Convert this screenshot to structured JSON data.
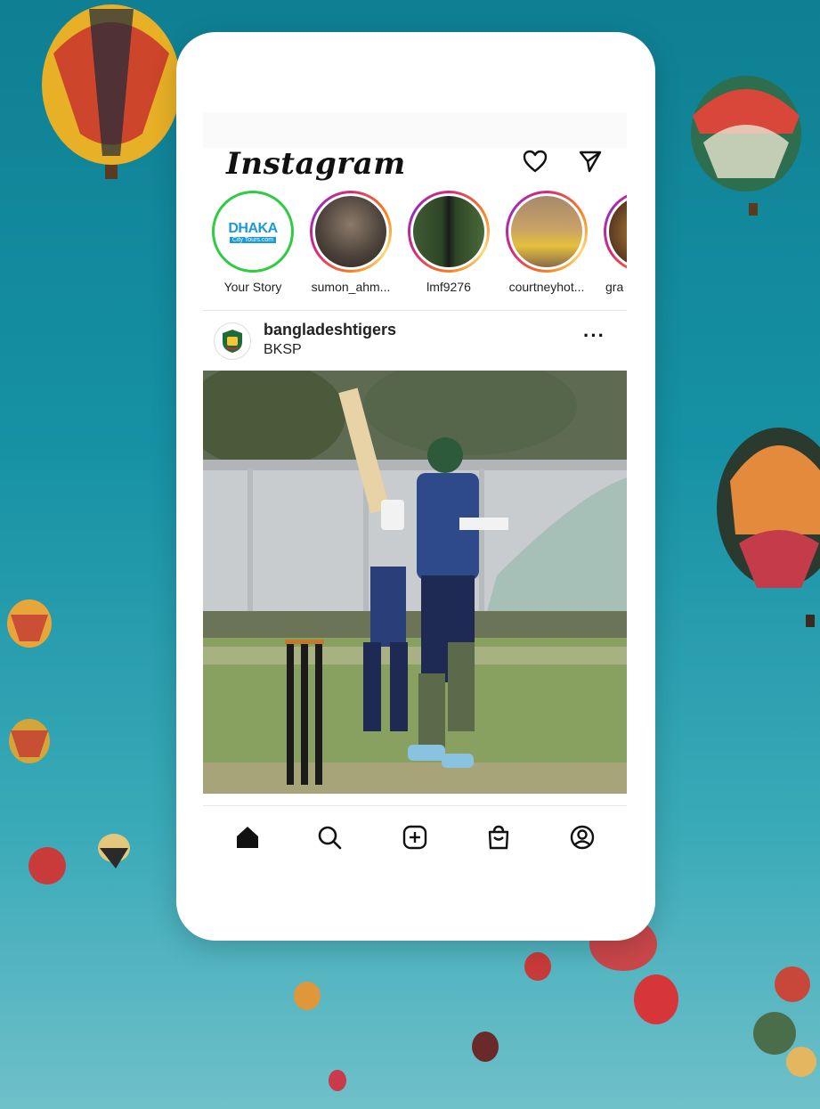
{
  "app": {
    "name": "Instagram"
  },
  "header": {
    "logo": "Instagram",
    "icons": [
      "heart-icon",
      "send-icon"
    ]
  },
  "stories": [
    {
      "label": "Your Story",
      "ring": "green",
      "avatar_text": "DHAKA",
      "avatar_sub": "City Tours.com"
    },
    {
      "label": "sumon_ahm...",
      "ring": "gradient"
    },
    {
      "label": "lmf9276",
      "ring": "gradient"
    },
    {
      "label": "courtneyhot...",
      "ring": "gradient"
    },
    {
      "label": "gra",
      "ring": "gradient"
    }
  ],
  "post": {
    "username": "bangladeshtigers",
    "location": "BKSP",
    "more_label": "···"
  },
  "nav": {
    "icons": [
      "home-icon",
      "search-icon",
      "add-post-icon",
      "shop-icon",
      "profile-icon"
    ]
  },
  "colors": {
    "background": "#1691a4",
    "story_ring_own": "#2ecc40",
    "accent": "#d62976"
  }
}
